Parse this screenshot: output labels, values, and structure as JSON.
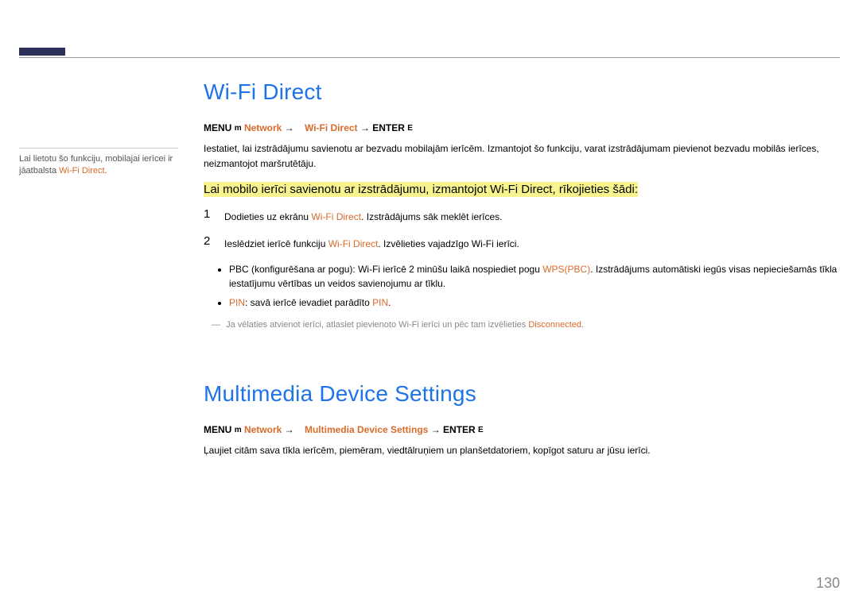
{
  "sidebar": {
    "note_prefix": "Lai lietotu šo funkciju, mobilajai ierīcei ir jāatbalsta ",
    "note_highlight": "Wi-Fi Direct",
    "note_suffix": "."
  },
  "section1": {
    "title": "Wi-Fi Direct",
    "path": {
      "menu": "MENU",
      "m_icon": "m",
      "network": "Network",
      "arrow": "→",
      "item": "Wi-Fi Direct",
      "enter": "ENTER",
      "e_icon": "E"
    },
    "intro": "Iestatiet, lai izstrādājumu savienotu ar bezvadu mobilajām ierīcēm. Izmantojot šo funkciju, varat izstrādājumam pievienot bezvadu mobilās ierīces, neizmantojot maršrutētāju.",
    "highlight": "Lai mobilo ierīci savienotu ar izstrādājumu, izmantojot Wi-Fi Direct, rīkojieties šādi:",
    "steps": [
      {
        "num": "1",
        "pre": "Dodieties uz ekrānu ",
        "hl": "Wi-Fi Direct",
        "post": ". Izstrādājums sāk meklēt ierīces."
      },
      {
        "num": "2",
        "pre": "Ieslēdziet ierīcē funkciju ",
        "hl": "Wi-Fi Direct",
        "post": ". Izvēlieties vajadzīgo Wi-Fi ierīci."
      }
    ],
    "bullets": [
      {
        "pre": "PBC (konfigurēšana ar pogu): Wi-Fi ierīcē 2 minūšu laikā nospiediet pogu ",
        "hl": "WPS(PBC)",
        "post": ". Izstrādājums automātiski iegūs visas nepieciešamās tīkla iestatījumu vērtības un veidos savienojumu ar tīklu."
      },
      {
        "pin_label": "PIN",
        "mid": ": savā ierīcē ievadiet parādīto ",
        "pin2": "PIN",
        "post": "."
      }
    ],
    "footnote": {
      "pre": "Ja vēlaties atvienot ierīci, atlasiet pievienoto Wi-Fi ierīci un pēc tam izvēlieties ",
      "hl": "Disconnected",
      "post": "."
    }
  },
  "section2": {
    "title": "Multimedia Device Settings",
    "path": {
      "menu": "MENU",
      "m_icon": "m",
      "network": "Network",
      "arrow": "→",
      "item": "Multimedia Device Settings",
      "enter": "ENTER",
      "e_icon": "E"
    },
    "body": "Ļaujiet citām sava tīkla ierīcēm, piemēram, viedtālruņiem un planšetdatoriem, kopīgot saturu ar jūsu ierīci."
  },
  "page_number": "130"
}
